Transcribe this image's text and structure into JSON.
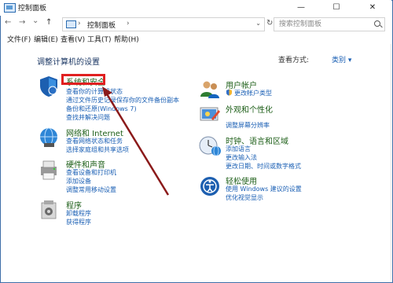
{
  "window": {
    "title": "控制面板",
    "min": "—",
    "max": "☐",
    "close": "✕"
  },
  "nav": {
    "back": "←",
    "forward": "→",
    "history": "⌄",
    "up": "↑",
    "sep": "›",
    "crumb": "控制面板",
    "dropdown": "⌄",
    "refresh": "↻"
  },
  "search": {
    "placeholder": "搜索控制面板"
  },
  "menu": [
    "文件(F)",
    "编辑(E)",
    "查看(V)",
    "工具(T)",
    "帮助(H)"
  ],
  "header": {
    "title": "调整计算机的设置",
    "view_by_label": "查看方式:",
    "view_by_value": "类别 ▾"
  },
  "categories": [
    {
      "title": "系统和安全",
      "links": [
        "查看你的计算机状态",
        "通过文件历史记录保存你的文件备份副本",
        "备份和还原(Windows 7)",
        "查找并解决问题"
      ],
      "icon": "shield-icon"
    },
    {
      "title": "网络和 Internet",
      "links": [
        "查看网络状态和任务",
        "选择家庭组和共享选项"
      ],
      "icon": "network-globe-icon"
    },
    {
      "title": "硬件和声音",
      "links": [
        "查看设备和打印机",
        "添加设备",
        "调整常用移动设置"
      ],
      "icon": "printer-icon"
    },
    {
      "title": "程序",
      "links": [
        "卸载程序",
        "获得程序"
      ],
      "icon": "programs-icon"
    },
    {
      "title": "用户帐户",
      "links": [
        "更改帐户类型"
      ],
      "icon": "users-icon"
    },
    {
      "title": "外观和个性化",
      "links": [
        "调整屏幕分辨率"
      ],
      "icon": "appearance-icon"
    },
    {
      "title": "时钟、语言和区域",
      "links": [
        "添加语言",
        "更改输入法",
        "更改日期、时间或数字格式"
      ],
      "icon": "clock-globe-icon"
    },
    {
      "title": "轻松使用",
      "links": [
        "使用 Windows 建议的设置",
        "优化视觉显示"
      ],
      "icon": "ease-of-access-icon"
    }
  ],
  "colors": {
    "accent_link": "#1a5fb4",
    "category_title": "#1c5e17",
    "highlight": "#e02020",
    "arrow": "#8b1a1a"
  }
}
